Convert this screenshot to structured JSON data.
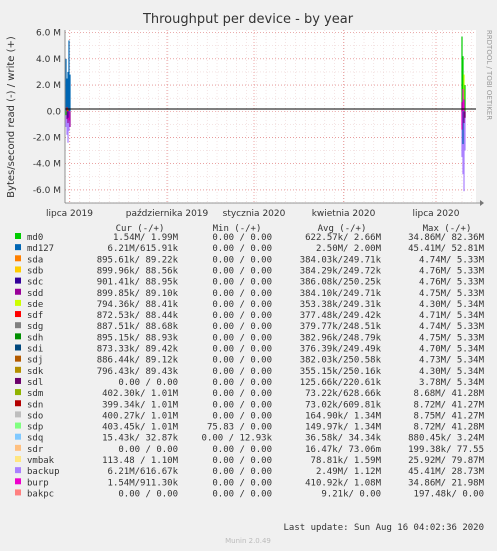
{
  "chart_data": {
    "type": "area",
    "title": "Throughput per device - by year",
    "ylabel": "Bytes/second read (-) / write (+)",
    "side_label": "RRDTOOL / TOBI OETIKER",
    "ylim": [
      -7000000,
      6200000
    ],
    "y_ticks": [
      {
        "value": 6000000,
        "label": "6.0 M"
      },
      {
        "value": 4000000,
        "label": "4.0 M"
      },
      {
        "value": 2000000,
        "label": "2.0 M"
      },
      {
        "value": 0,
        "label": "0.0"
      },
      {
        "value": -2000000,
        "label": "-2.0 M"
      },
      {
        "value": -4000000,
        "label": "-4.0 M"
      },
      {
        "value": -6000000,
        "label": "-6.0 M"
      }
    ],
    "x_ticks": [
      "lipca 2019",
      "października 2019",
      "stycznia 2020",
      "kwietnia 2020",
      "lipca 2020"
    ],
    "grid": true,
    "legend_header": {
      "cur": "Cur (-/+)",
      "min": "Min (-/+)",
      "avg": "Avg (-/+)",
      "max": "Max (-/+)"
    },
    "series": [
      {
        "name": "md0",
        "color": "#00cc00",
        "cur": "1.54M/  1.99M",
        "min": "0.00 /  0.00",
        "avg": "622.57k/  2.66M",
        "max": "34.86M/ 82.36M"
      },
      {
        "name": "md127",
        "color": "#0066b3",
        "cur": "6.21M/615.91k",
        "min": "0.00 /  0.00",
        "avg": "2.50M/  2.00M",
        "max": "45.41M/ 52.81M"
      },
      {
        "name": "sda",
        "color": "#ff8000",
        "cur": "895.61k/ 89.22k",
        "min": "0.00 /  0.00",
        "avg": "384.03k/249.71k",
        "max": "4.74M/  5.33M"
      },
      {
        "name": "sdb",
        "color": "#ffcc00",
        "cur": "899.96k/ 88.56k",
        "min": "0.00 /  0.00",
        "avg": "384.29k/249.72k",
        "max": "4.76M/  5.33M"
      },
      {
        "name": "sdc",
        "color": "#330099",
        "cur": "901.41k/ 88.95k",
        "min": "0.00 /  0.00",
        "avg": "386.08k/250.25k",
        "max": "4.76M/  5.33M"
      },
      {
        "name": "sdd",
        "color": "#990099",
        "cur": "899.85k/ 89.10k",
        "min": "0.00 /  0.00",
        "avg": "384.10k/249.71k",
        "max": "4.75M/  5.33M"
      },
      {
        "name": "sde",
        "color": "#ccff00",
        "cur": "794.36k/ 88.41k",
        "min": "0.00 /  0.00",
        "avg": "353.38k/249.31k",
        "max": "4.30M/  5.34M"
      },
      {
        "name": "sdf",
        "color": "#ff0000",
        "cur": "872.53k/ 88.44k",
        "min": "0.00 /  0.00",
        "avg": "377.48k/249.42k",
        "max": "4.71M/  5.34M"
      },
      {
        "name": "sdg",
        "color": "#808080",
        "cur": "887.51k/ 88.68k",
        "min": "0.00 /  0.00",
        "avg": "379.77k/248.51k",
        "max": "4.74M/  5.33M"
      },
      {
        "name": "sdh",
        "color": "#008f00",
        "cur": "895.15k/ 88.93k",
        "min": "0.00 /  0.00",
        "avg": "382.96k/248.79k",
        "max": "4.75M/  5.33M"
      },
      {
        "name": "sdi",
        "color": "#00487d",
        "cur": "873.33k/ 89.42k",
        "min": "0.00 /  0.00",
        "avg": "376.39k/249.49k",
        "max": "4.70M/  5.34M"
      },
      {
        "name": "sdj",
        "color": "#b35a00",
        "cur": "886.44k/ 89.12k",
        "min": "0.00 /  0.00",
        "avg": "382.03k/250.58k",
        "max": "4.73M/  5.34M"
      },
      {
        "name": "sdk",
        "color": "#b38f00",
        "cur": "796.43k/ 89.43k",
        "min": "0.00 /  0.00",
        "avg": "355.15k/250.16k",
        "max": "4.30M/  5.34M"
      },
      {
        "name": "sdl",
        "color": "#6b006b",
        "cur": "0.00 /  0.00",
        "min": "0.00 /  0.00",
        "avg": "125.66k/220.61k",
        "max": "3.78M/  5.34M"
      },
      {
        "name": "sdm",
        "color": "#8fb300",
        "cur": "402.30k/  1.01M",
        "min": "0.00 /  0.00",
        "avg": "73.22k/628.66k",
        "max": "8.68M/ 41.28M"
      },
      {
        "name": "sdn",
        "color": "#b30000",
        "cur": "399.34k/  1.01M",
        "min": "0.00 /  0.00",
        "avg": "73.02k/609.81k",
        "max": "8.72M/ 41.27M"
      },
      {
        "name": "sdo",
        "color": "#bebebe",
        "cur": "400.27k/  1.01M",
        "min": "0.00 /  0.00",
        "avg": "164.90k/  1.34M",
        "max": "8.75M/ 41.27M"
      },
      {
        "name": "sdp",
        "color": "#80ff80",
        "cur": "403.45k/  1.01M",
        "min": "75.83 /  0.00",
        "avg": "149.97k/  1.34M",
        "max": "8.72M/ 41.28M"
      },
      {
        "name": "sdq",
        "color": "#80c9ff",
        "cur": "15.43k/ 32.87k",
        "min": "0.00 / 12.93k",
        "avg": "36.58k/ 34.34k",
        "max": "880.45k/  3.24M"
      },
      {
        "name": "sdr",
        "color": "#ffc080",
        "cur": "0.00 /  0.00",
        "min": "0.00 /  0.00",
        "avg": "16.47k/ 73.06m",
        "max": "199.38k/ 77.55"
      },
      {
        "name": "vmbak",
        "color": "#ffe680",
        "cur": "113.48 /  1.10M",
        "min": "0.00 /  0.00",
        "avg": "78.81k/  1.59M",
        "max": "25.92M/ 79.87M"
      },
      {
        "name": "backup",
        "color": "#aa80ff",
        "cur": "6.21M/616.67k",
        "min": "0.00 /  0.00",
        "avg": "2.49M/  1.12M",
        "max": "45.41M/ 28.73M"
      },
      {
        "name": "burp",
        "color": "#ee00cc",
        "cur": "1.54M/911.30k",
        "min": "0.00 /  0.00",
        "avg": "410.92k/  1.08M",
        "max": "34.86M/ 21.98M"
      },
      {
        "name": "bakpc",
        "color": "#ff8080",
        "cur": "0.00 /  0.00",
        "min": "0.00 /  0.00",
        "avg": "9.21k/  0.00",
        "max": "197.48k/  0.00"
      }
    ],
    "last_update": "Last update: Sun Aug 16 04:02:36 2020",
    "footer": "Munin 2.0.49"
  }
}
